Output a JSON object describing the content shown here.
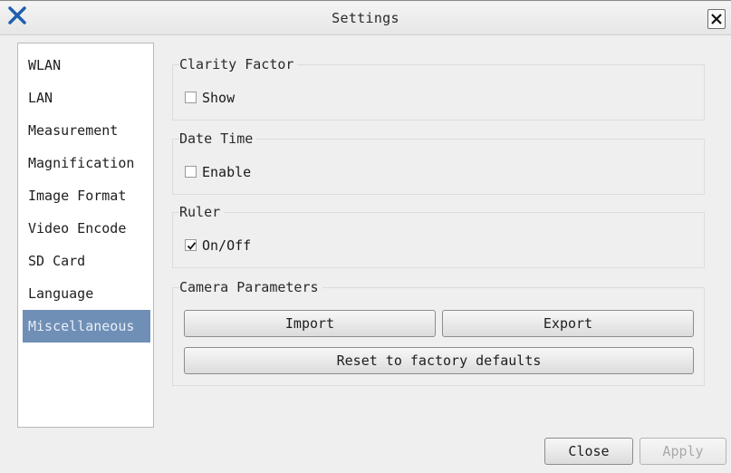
{
  "window": {
    "title": "Settings"
  },
  "sidebar": {
    "items": [
      {
        "label": "WLAN",
        "selected": false
      },
      {
        "label": "LAN",
        "selected": false
      },
      {
        "label": "Measurement",
        "selected": false
      },
      {
        "label": "Magnification",
        "selected": false
      },
      {
        "label": "Image Format",
        "selected": false
      },
      {
        "label": "Video Encode",
        "selected": false
      },
      {
        "label": "SD Card",
        "selected": false
      },
      {
        "label": "Language",
        "selected": false
      },
      {
        "label": "Miscellaneous",
        "selected": true
      }
    ]
  },
  "groups": {
    "clarity": {
      "title": "Clarity Factor",
      "checkbox_label": "Show",
      "checked": false
    },
    "datetime": {
      "title": "Date Time",
      "checkbox_label": "Enable",
      "checked": false
    },
    "ruler": {
      "title": "Ruler",
      "checkbox_label": "On/Off",
      "checked": true
    },
    "camera": {
      "title": "Camera Parameters",
      "import_label": "Import",
      "export_label": "Export",
      "reset_label": "Reset to factory defaults"
    }
  },
  "footer": {
    "close_label": "Close",
    "apply_label": "Apply",
    "apply_enabled": false
  },
  "colors": {
    "selected_bg": "#6f8fb6",
    "app_icon": "#1f5fb0"
  },
  "icons": {
    "app": "x-logo-icon",
    "close": "close-icon",
    "check": "checkmark-icon"
  }
}
